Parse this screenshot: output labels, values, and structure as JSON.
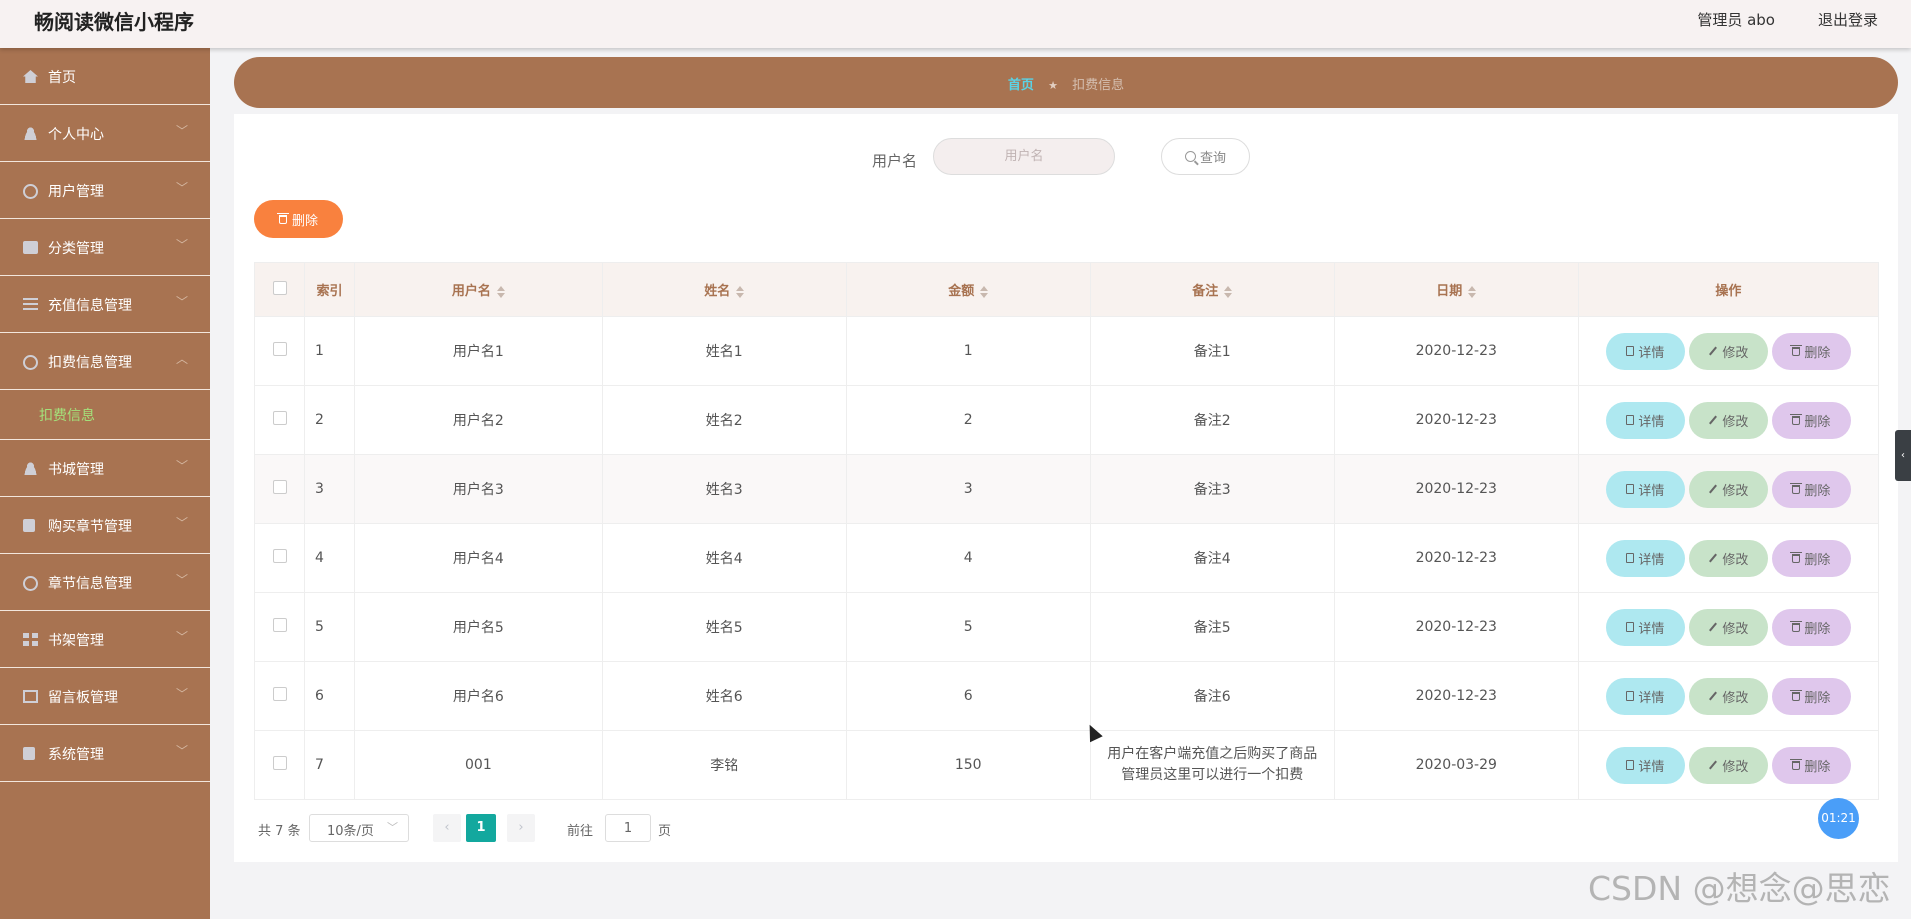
{
  "app": {
    "title": "畅阅读微信小程序"
  },
  "header": {
    "admin": "管理员 abo",
    "logout": "退出登录"
  },
  "sidebar": {
    "items": [
      {
        "label": "首页",
        "icon": "home-icon"
      },
      {
        "label": "个人中心",
        "icon": "user-icon"
      },
      {
        "label": "用户管理",
        "icon": "circle-icon"
      },
      {
        "label": "分类管理",
        "icon": "monitor-icon"
      },
      {
        "label": "充值信息管理",
        "icon": "list-icon"
      },
      {
        "label": "扣费信息管理",
        "icon": "loading-icon",
        "expanded": true,
        "children": [
          {
            "label": "扣费信息",
            "active": true
          }
        ]
      },
      {
        "label": "书城管理",
        "icon": "user-icon"
      },
      {
        "label": "购买章节管理",
        "icon": "clipboard-icon"
      },
      {
        "label": "章节信息管理",
        "icon": "circle-icon"
      },
      {
        "label": "书架管理",
        "icon": "grid-icon"
      },
      {
        "label": "留言板管理",
        "icon": "board-icon"
      },
      {
        "label": "系统管理",
        "icon": "clipboard-icon"
      }
    ]
  },
  "breadcrumb": {
    "home": "首页",
    "separator": "★",
    "current": "扣费信息"
  },
  "search": {
    "label": "用户名",
    "placeholder": "用户名",
    "button": "查询"
  },
  "toolbar": {
    "delete": "删除"
  },
  "table": {
    "headers": [
      "索引",
      "用户名",
      "姓名",
      "金额",
      "备注",
      "日期",
      "操作"
    ],
    "rows": [
      {
        "index": "1",
        "username": "用户名1",
        "name": "姓名1",
        "amount": "1",
        "note": "备注1",
        "date": "2020-12-23"
      },
      {
        "index": "2",
        "username": "用户名2",
        "name": "姓名2",
        "amount": "2",
        "note": "备注2",
        "date": "2020-12-23"
      },
      {
        "index": "3",
        "username": "用户名3",
        "name": "姓名3",
        "amount": "3",
        "note": "备注3",
        "date": "2020-12-23"
      },
      {
        "index": "4",
        "username": "用户名4",
        "name": "姓名4",
        "amount": "4",
        "note": "备注4",
        "date": "2020-12-23"
      },
      {
        "index": "5",
        "username": "用户名5",
        "name": "姓名5",
        "amount": "5",
        "note": "备注5",
        "date": "2020-12-23"
      },
      {
        "index": "6",
        "username": "用户名6",
        "name": "姓名6",
        "amount": "6",
        "note": "备注6",
        "date": "2020-12-23"
      },
      {
        "index": "7",
        "username": "001",
        "name": "李铭",
        "amount": "150",
        "note_line1": "用户在客户端充值之后购买了商品",
        "note_line2": "管理员这里可以进行一个扣费",
        "date": "2020-03-29"
      }
    ],
    "actions": {
      "detail": "详情",
      "edit": "修改",
      "delete": "删除"
    }
  },
  "pagination": {
    "total": "共 7 条",
    "page_size": "10条/页",
    "current": "1",
    "goto_label": "前往",
    "goto_value": "1",
    "page_suffix": "页",
    "prev": "‹",
    "next": "›"
  },
  "timer": "01:21",
  "side_tab": "‹",
  "watermark": "CSDN @想念@思恋",
  "colors": {
    "sidebar": "#a87351",
    "accent": "#13a89e",
    "delete": "#f9813e"
  }
}
